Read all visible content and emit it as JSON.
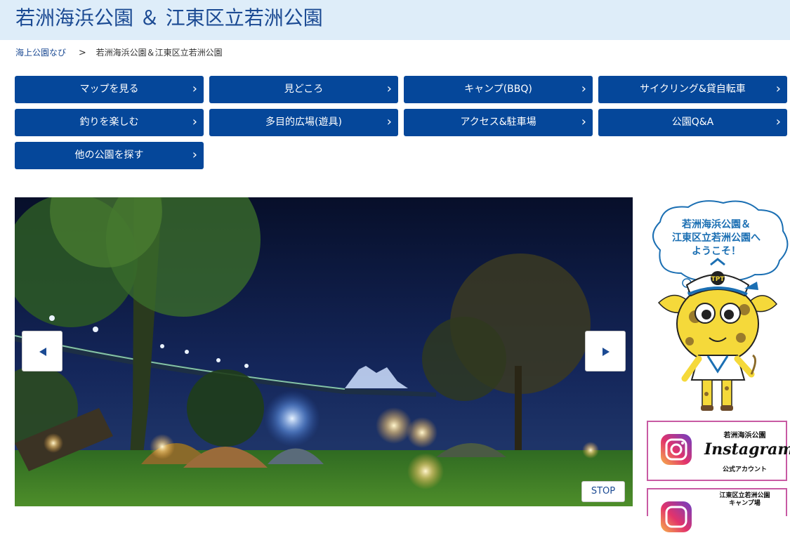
{
  "header": {
    "title": "若洲海浜公園 ＆ 江東区立若洲公園"
  },
  "breadcrumb": {
    "home": "海上公園なび",
    "separator": ">",
    "current": "若洲海浜公園＆江東区立若洲公園"
  },
  "nav": {
    "chevron": "›",
    "items": [
      {
        "label": "マップを見る"
      },
      {
        "label": "見どころ"
      },
      {
        "label": "キャンプ(BBQ)"
      },
      {
        "label": "サイクリング&貸自転車"
      },
      {
        "label": "釣りを楽しむ"
      },
      {
        "label": "多目的広場(遊具)"
      },
      {
        "label": "アクセス&駐車場"
      },
      {
        "label": "公園Q&A"
      },
      {
        "label": "他の公園を探す"
      }
    ]
  },
  "slider": {
    "stop_label": "STOP",
    "prev_icon": "triangle-left-icon",
    "next_icon": "triangle-right-icon"
  },
  "sidebar": {
    "bubble_lines": [
      "若洲海浜公園＆",
      "江東区立若洲公園へ",
      "ようこそ！"
    ],
    "cap_text": "TPT",
    "banner1": {
      "park": "若洲海浜公園",
      "brand": "Instagram",
      "official": "公式アカウント"
    },
    "banner2": {
      "park_lines": [
        "江東区立若洲公園",
        "キャンプ場"
      ]
    }
  },
  "colors": {
    "header_bg": "#deedf9",
    "title": "#1b4a93",
    "nav_bg": "#05479a",
    "banner_border": "#c85aa3"
  }
}
